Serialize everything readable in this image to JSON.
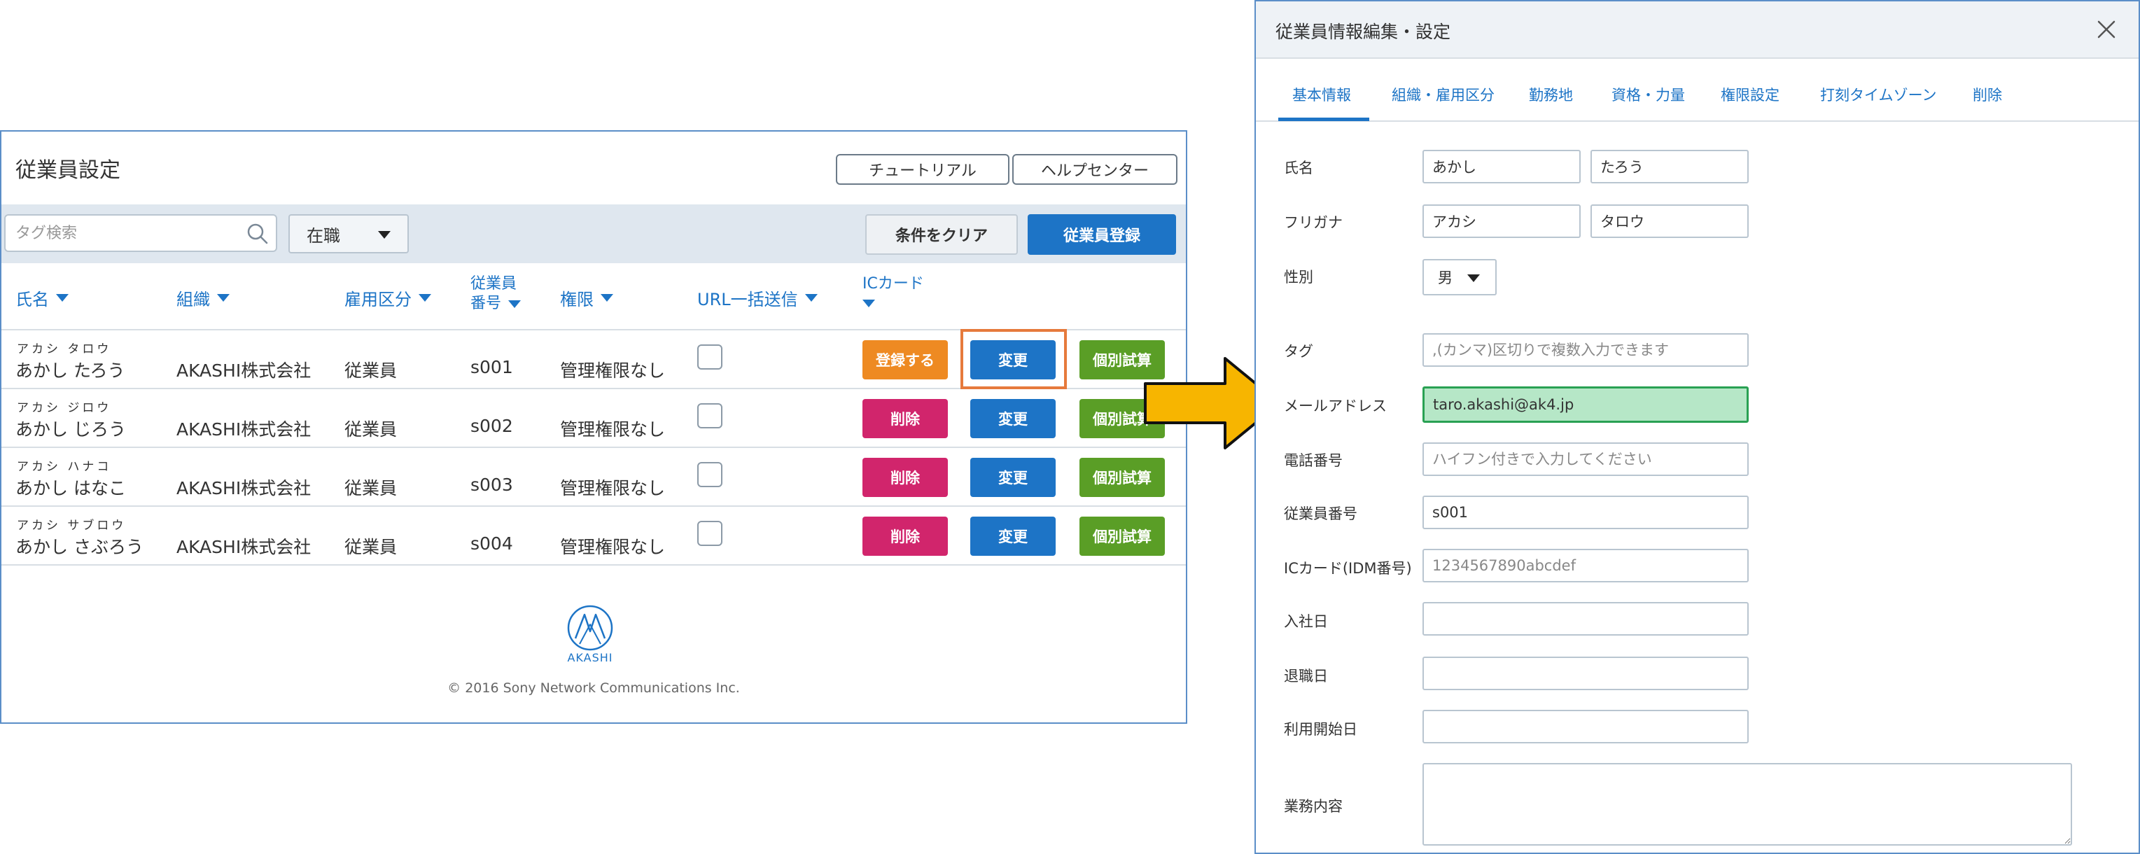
{
  "list_panel": {
    "title": "従業員設定",
    "tutorial_label": "チュートリアル",
    "help_label": "ヘルプセンター",
    "search_placeholder": "タグ検索",
    "status_value": "在職",
    "clear_label": "条件をクリア",
    "register_label": "従業員登録",
    "columns": {
      "name": "氏名",
      "org": "組織",
      "employment": "雇用区分",
      "emp_no_line1": "従業員",
      "emp_no_line2": "番号",
      "permission": "権限",
      "url_send": "URL一括送信",
      "ic_card": "ICカード"
    },
    "rows": [
      {
        "kana": "アカシ タロウ",
        "name": "あかし たろう",
        "org": "AKASHI株式会社",
        "employment": "従業員",
        "emp_no": "s001",
        "permission": "管理権限なし",
        "ic_button": "登録する",
        "edit_button": "変更",
        "test_button": "個別試算"
      },
      {
        "kana": "アカシ ジロウ",
        "name": "あかし じろう",
        "org": "AKASHI株式会社",
        "employment": "従業員",
        "emp_no": "s002",
        "permission": "管理権限なし",
        "ic_button": "削除",
        "edit_button": "変更",
        "test_button": "個別試算"
      },
      {
        "kana": "アカシ ハナコ",
        "name": "あかし はなこ",
        "org": "AKASHI株式会社",
        "employment": "従業員",
        "emp_no": "s003",
        "permission": "管理権限なし",
        "ic_button": "削除",
        "edit_button": "変更",
        "test_button": "個別試算"
      },
      {
        "kana": "アカシ サブロウ",
        "name": "あかし さぶろう",
        "org": "AKASHI株式会社",
        "employment": "従業員",
        "emp_no": "s004",
        "permission": "管理権限なし",
        "ic_button": "削除",
        "edit_button": "変更",
        "test_button": "個別試算"
      }
    ],
    "logo_text": "AKASHI",
    "copyright": "© 2016 Sony Network Communications Inc."
  },
  "edit_panel": {
    "title": "従業員情報編集・設定",
    "tabs": [
      "基本情報",
      "組織・雇用区分",
      "勤務地",
      "資格・力量",
      "権限設定",
      "打刻タイムゾーン",
      "削除"
    ],
    "active_tab": "基本情報",
    "fields": {
      "name_label": "氏名",
      "last_name": "あかし",
      "first_name": "たろう",
      "furigana_label": "フリガナ",
      "last_kana": "アカシ",
      "first_kana": "タロウ",
      "gender_label": "性別",
      "gender_value": "男",
      "tag_label": "タグ",
      "tag_placeholder": ",(カンマ)区切りで複数入力できます",
      "email_label": "メールアドレス",
      "email_value": "taro.akashi@ak4.jp",
      "phone_label": "電話番号",
      "phone_placeholder": "ハイフン付きで入力してください",
      "emp_no_label": "従業員番号",
      "emp_no_value": "s001",
      "ic_label": "ICカード(IDM番号)",
      "ic_placeholder": "1234567890abcdef",
      "join_label": "入社日",
      "leave_label": "退職日",
      "start_label": "利用開始日",
      "duty_label": "業務内容"
    }
  },
  "colors": {
    "accent_blue": "#1d74c6",
    "orange": "#ee8a22",
    "pink": "#d1256c",
    "green": "#5a9e26",
    "highlight": "#e67a3c",
    "arrow_fill": "#f7b500",
    "email_highlight": "#b6e7c7"
  }
}
